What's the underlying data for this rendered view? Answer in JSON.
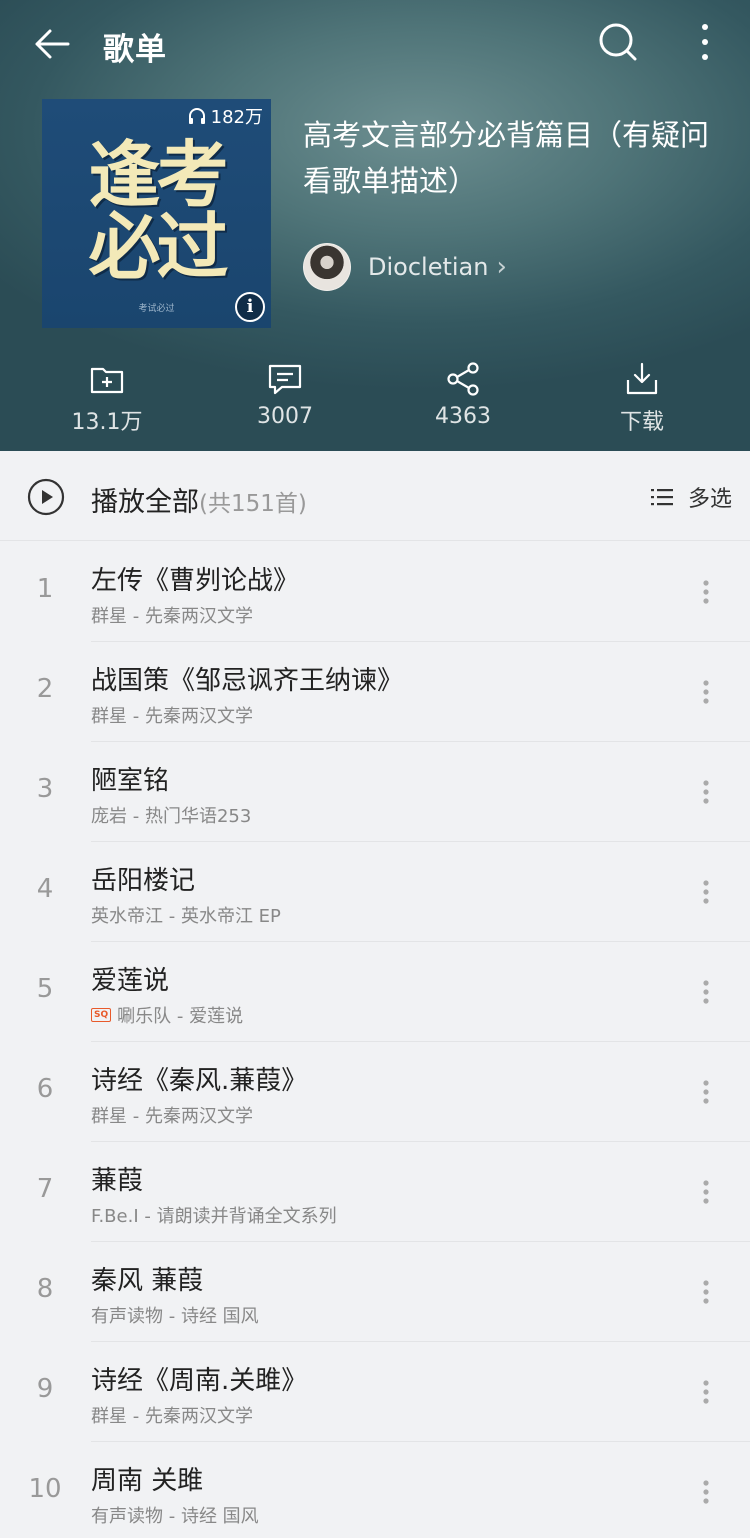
{
  "topbar": {
    "title": "歌单"
  },
  "cover": {
    "plays": "182万",
    "line1": "逢考",
    "line2": "必过",
    "caption": "考试必过"
  },
  "playlist": {
    "title": "高考文言部分必背篇目（有疑问看歌单描述）",
    "creator": "Diocletian"
  },
  "actions": [
    {
      "label": "13.1万",
      "icon": "folder-add-icon"
    },
    {
      "label": "3007",
      "icon": "comment-icon"
    },
    {
      "label": "4363",
      "icon": "share-icon"
    },
    {
      "label": "下载",
      "icon": "download-icon"
    }
  ],
  "playall": {
    "label": "播放全部",
    "count": "(共151首)",
    "multi": "多选"
  },
  "songs": [
    {
      "index": "1",
      "title": "左传《曹刿论战》",
      "subtitle": "群星 - 先秦两汉文学",
      "sq": false
    },
    {
      "index": "2",
      "title": "战国策《邹忌讽齐王纳谏》",
      "subtitle": "群星 - 先秦两汉文学",
      "sq": false
    },
    {
      "index": "3",
      "title": "陋室铭",
      "subtitle": "庞岩 - 热门华语253",
      "sq": false
    },
    {
      "index": "4",
      "title": "岳阳楼记",
      "subtitle": "英水帝江 - 英水帝江 EP",
      "sq": false
    },
    {
      "index": "5",
      "title": "爱莲说",
      "subtitle": "唰乐队 - 爱莲说",
      "sq": true,
      "sq_label": "SQ"
    },
    {
      "index": "6",
      "title": "诗经《秦风.蒹葭》",
      "subtitle": "群星 - 先秦两汉文学",
      "sq": false
    },
    {
      "index": "7",
      "title": "蒹葭",
      "subtitle": "F.Be.I - 请朗读并背诵全文系列",
      "sq": false
    },
    {
      "index": "8",
      "title": "秦风 蒹葭",
      "subtitle": "有声读物 - 诗经 国风",
      "sq": false
    },
    {
      "index": "9",
      "title": "诗经《周南.关雎》",
      "subtitle": "群星 - 先秦两汉文学",
      "sq": false
    },
    {
      "index": "10",
      "title": "周南 关雎",
      "subtitle": "有声读物 - 诗经 国风",
      "sq": false
    }
  ]
}
